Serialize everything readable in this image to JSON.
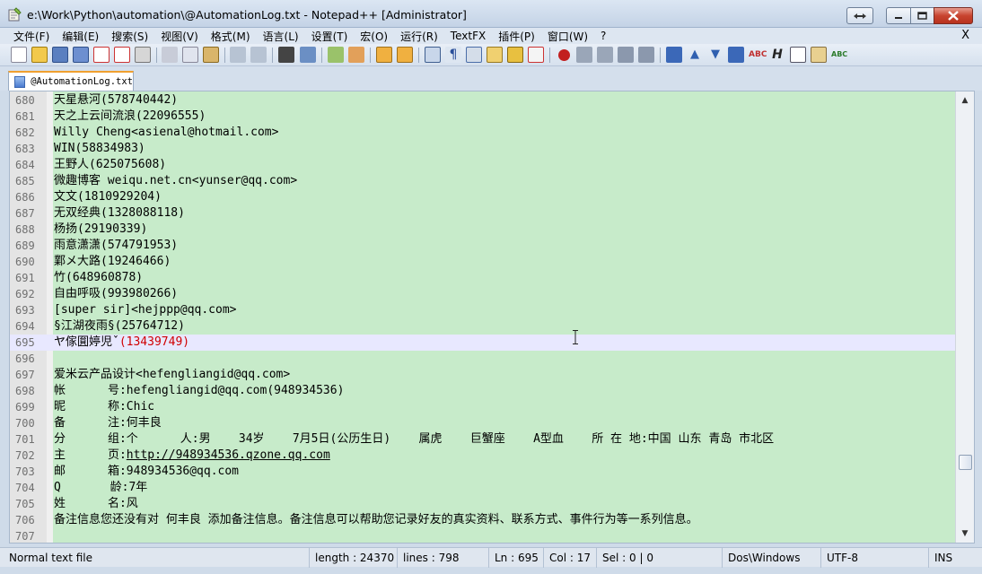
{
  "window": {
    "title": "e:\\Work\\Python\\automation\\@AutomationLog.txt - Notepad++ [Administrator]"
  },
  "menu": [
    "文件(F)",
    "编辑(E)",
    "搜索(S)",
    "视图(V)",
    "格式(M)",
    "语言(L)",
    "设置(T)",
    "宏(O)",
    "运行(R)",
    "TextFX",
    "插件(P)",
    "窗口(W)",
    "?"
  ],
  "menu_close": "X",
  "tab": {
    "label": "@AutomationLog.txt"
  },
  "editor": {
    "lines": [
      {
        "n": "680",
        "text": "天星悬河(578740442)"
      },
      {
        "n": "681",
        "text": "天之上云间流浪(22096555)"
      },
      {
        "n": "682",
        "text": "Willy Cheng<asienal@hotmail.com>"
      },
      {
        "n": "683",
        "text": "WIN(58834983)"
      },
      {
        "n": "684",
        "text": "王野人(625075608)"
      },
      {
        "n": "685",
        "text": "微趣博客 weiqu.net.cn<yunser@qq.com>"
      },
      {
        "n": "686",
        "text": "文文(1810929204)"
      },
      {
        "n": "687",
        "text": "无双经典(1328088118)"
      },
      {
        "n": "688",
        "text": "杨扬(29190339)"
      },
      {
        "n": "689",
        "text": "雨意潇潇(574791953)"
      },
      {
        "n": "690",
        "text": "鄴メ大路(19246466)"
      },
      {
        "n": "691",
        "text": "竹(648960878)"
      },
      {
        "n": "692",
        "text": "自由呼吸(993980266)"
      },
      {
        "n": "693",
        "text": "[super sir]<hejppp@qq.com>"
      },
      {
        "n": "694",
        "text": "§江湖夜雨§(25764712)"
      },
      {
        "n": "695",
        "text": "ヤ傢圎婷児ˇ",
        "hl": "(13439749)"
      },
      {
        "n": "696",
        "text": ""
      },
      {
        "n": "697",
        "text": "爱米云产品设计<hefengliangid@qq.com>"
      },
      {
        "n": "698",
        "text": "帐      号:hefengliangid@qq.com(948934536)"
      },
      {
        "n": "699",
        "text": "昵      称:Chic"
      },
      {
        "n": "700",
        "text": "备      注:何丰良"
      },
      {
        "n": "701",
        "text": "分      组:个      人:男    34岁    7月5日(公历生日)    属虎    巨蟹座    A型血    所 在 地:中国 山东 青岛 市北区"
      },
      {
        "n": "702",
        "text": "主      页:",
        "link": "http://948934536.qzone.qq.com"
      },
      {
        "n": "703",
        "text": "邮      箱:948934536@qq.com"
      },
      {
        "n": "704",
        "text": "Q       龄:7年"
      },
      {
        "n": "705",
        "text": "姓      名:风"
      },
      {
        "n": "706",
        "text": "备注信息您还没有对 何丰良 添加备注信息。备注信息可以帮助您记录好友的真实资料、联系方式、事件行为等一系列信息。"
      },
      {
        "n": "707",
        "text": ""
      }
    ]
  },
  "status": {
    "file_type": "Normal text file",
    "length": "length : 24370",
    "lines": "lines : 798",
    "ln": "Ln : 695",
    "col": "Col : 17",
    "sel": "Sel : 0 | 0",
    "eol": "Dos\\Windows",
    "encoding": "UTF-8",
    "mode": "INS"
  },
  "colors": {
    "editor_bg": "#c7ebca",
    "current_line": "#e8e8ff",
    "brace_highlight": "#d00000"
  }
}
